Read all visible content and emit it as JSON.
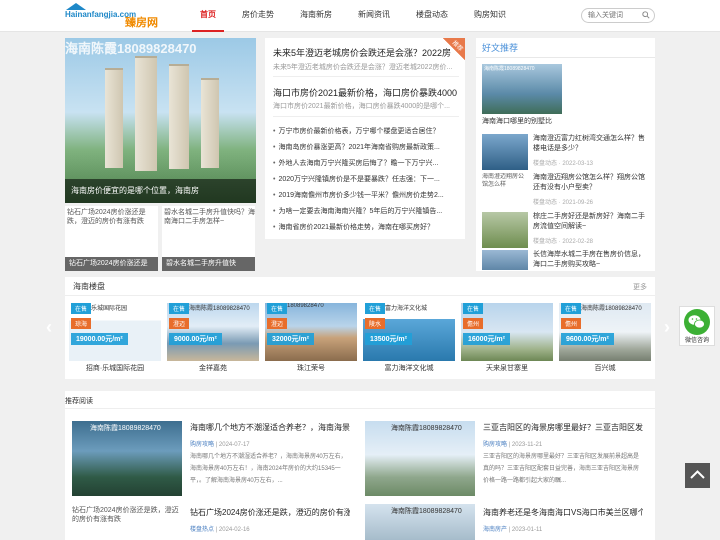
{
  "header": {
    "logo_en": "Hainanfangjia.com",
    "logo_cn": "臻房网",
    "nav": [
      "首页",
      "房价走势",
      "海南新房",
      "新闻资讯",
      "楼盘动态",
      "购房知识"
    ],
    "search_placeholder": "输入关键词"
  },
  "slider": {
    "banner_text": "海南陈霞18089828470",
    "caption": "海南房价便宜的是哪个位置，海南房",
    "thumbs": [
      {
        "alt": "钻石广场2024房价涨还是跌，澄迈的房价有涨有跌",
        "caption": "钻石广场2024房价涨还是"
      },
      {
        "alt": "碧水名城二手房升值快吗？海南海口二手房怎样~",
        "caption": "碧水名城二手房升值快"
      }
    ]
  },
  "news": {
    "ribbon": "推荐",
    "lead": [
      {
        "title": "未来5年澄迈老城房价会跌还是会涨？2022房",
        "summary": "未来5年澄迈老城房价会跌还是会涨？澄迈老城2022房价..."
      },
      {
        "title": "海口市房价2021最新价格，海口房价暴跌4000",
        "summary": "海口市房价2021最新价格，海口房价暴跌4000的是哪个..."
      }
    ],
    "items": [
      "万宁市房价最新价格表，万宁哪个楼盘更适合居住？",
      "海南岛房价暴涨更高？2021年海南省购房最新政策...",
      "外地人去海南万宁兴隆买房后悔了？瞻一下万宁兴...",
      "2020万宁兴隆镇房价是不是要暴跌？任志强：下一...",
      "2019海南儋州市房价多少钱一平米？儋州房价走势2...",
      "为啥一定要去海南海南兴隆？5年后的万宁兴隆镇告...",
      "海南省房价2021最新价格走势，海南在哪买房好？"
    ]
  },
  "sidebar": {
    "title": "好文推荐",
    "hero_tag": "海南陈霞18089828470",
    "hero_caption": "海南海口哪里的别墅比",
    "items": [
      {
        "img_alt": "",
        "title": "海南澄迈富力红树湾交通怎么样？售楼电话是多少？",
        "meta": "楼盘动态 · 2022-03-13"
      },
      {
        "img_alt": "海南澄迈翔房公馆怎么样",
        "title": "海南澄迈翔房公馆怎么样？翔房公馆还有没有小户型卖？",
        "meta": "楼盘动态 · 2021-09-26"
      },
      {
        "img_alt": "",
        "title": "棕庄二手房好还是新房好？海南二手房流值空间解读~",
        "meta": "楼盘动态 · 2022-02-28"
      },
      {
        "img_alt": "",
        "title": "长信海岸水城二手房在售房价信息，海口二手房购买攻略~",
        "meta": ""
      }
    ]
  },
  "listings": {
    "title": "海南楼盘",
    "more": "更多",
    "cards": [
      {
        "status": "在售",
        "area": "琼海",
        "price": "19000.00元/m²",
        "name": "招商·乐城国际花园",
        "toptext": "乐城国际花园"
      },
      {
        "status": "在售",
        "area": "澄迈",
        "price": "9000.00元/m²",
        "name": "金祥嘉苑",
        "toptext": "海南陈霞18089828470"
      },
      {
        "status": "在售",
        "area": "澄迈",
        "price": "32000元/m²",
        "name": "珠江荣号",
        "toptext": "18089828470"
      },
      {
        "status": "在售",
        "area": "陵水",
        "price": "13500元/m²",
        "name": "富力海洋文化城",
        "toptext": "富力海洋文化城"
      },
      {
        "status": "在售",
        "area": "儋州",
        "price": "16000元/m²",
        "name": "天来泉甘寨里",
        "toptext": ""
      },
      {
        "status": "在售",
        "area": "儋州",
        "price": "9600.00元/m²",
        "name": "百兴城",
        "toptext": "海南陈霞18089828470"
      }
    ]
  },
  "wechat": {
    "label": "微信咨询"
  },
  "feed": {
    "title": "推荐阅读",
    "articles": [
      {
        "img_tag": "海南陈霞18089828470",
        "title": "海南哪几个地方不潮湿适合养老？，海南海景",
        "tag": "购房攻略",
        "date": "2024-07-17",
        "summary": "海南哪几个地方不潮湿适合养老？，海南海景房40万左右，海南海景房40万左右！，海南2024年房价的大约15345一平，。了解海南海景房40万左右，..."
      },
      {
        "img_tag": "海南陈霞18089828470",
        "title": "三亚吉阳区的海景房哪里最好？三亚吉阳区发",
        "tag": "购房攻略",
        "date": "2023-11-21",
        "summary": "三亚吉阳区的海景房哪里最好？三亚吉阳区发展前景超高是真的吗？三亚吉阳区配套日益完善，海南三亚吉阳区海景房价格一路一路都引起大家的瞩..."
      },
      {
        "img_alt": "钻石广场2024房价涨还是跌，澄迈的房价有涨有跌",
        "title": "钻石广场2024房价涨还是跌，澄迈的房价有涨",
        "tag": "楼盘热点",
        "date": "2024-02-16"
      },
      {
        "img_tag": "海南陈霞18089828470",
        "title": "海南养老还是冬海南海口VS海口市美兰区哪个适",
        "tag": "海南房产",
        "date": "2023-01-11"
      }
    ]
  }
}
